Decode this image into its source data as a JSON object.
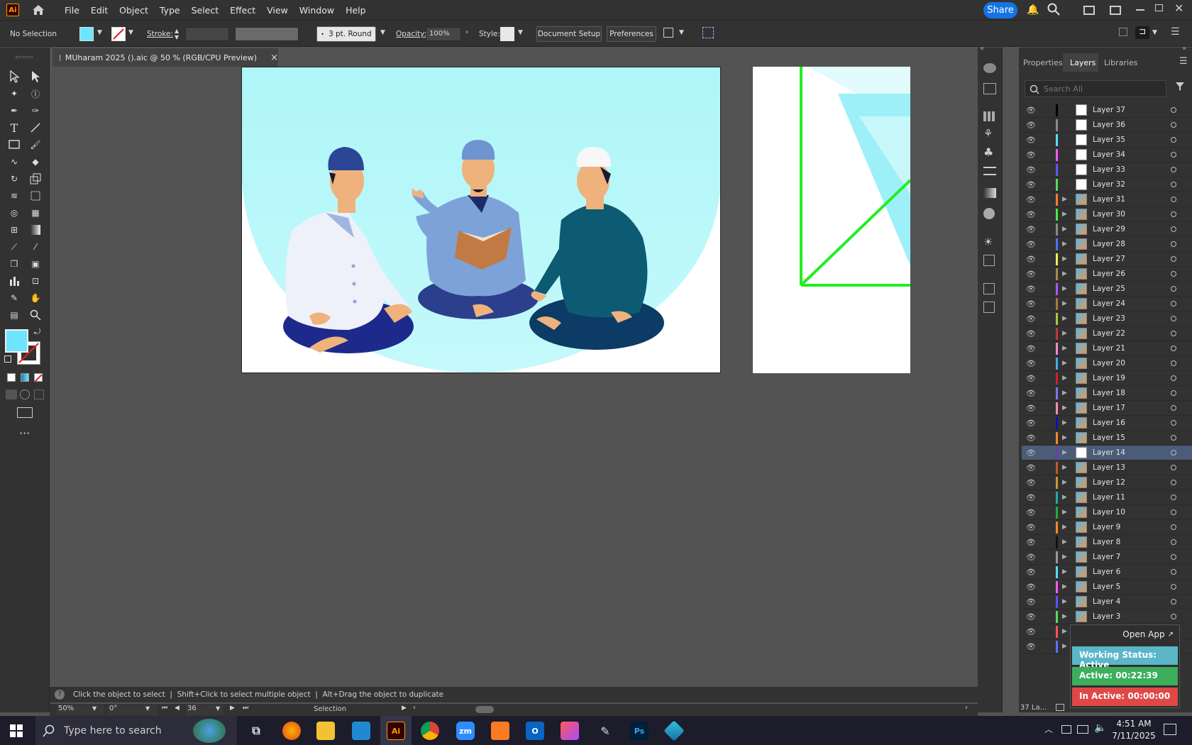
{
  "app": {
    "logo": "Ai",
    "menus": [
      "File",
      "Edit",
      "Object",
      "Type",
      "Select",
      "Effect",
      "View",
      "Window",
      "Help"
    ],
    "share_label": "Share"
  },
  "control": {
    "selection": "No Selection",
    "stroke_label": "Stroke:",
    "brush": "3 pt. Round",
    "opacity_label": "Opacity:",
    "opacity_value": "100%",
    "style_label": "Style:",
    "document_setup": "Document Setup",
    "preferences": "Preferences"
  },
  "document": {
    "tab_title": "MUharam 2025 ().aic @ 50 % (RGB/CPU Preview)"
  },
  "panel": {
    "tabs": [
      "Properties",
      "Layers",
      "Libraries"
    ],
    "search_placeholder": "Search All",
    "layer_count": "37 La..."
  },
  "layers": [
    {
      "name": "Layer 37",
      "color": "#000000",
      "expand": false,
      "thumb": "white"
    },
    {
      "name": "Layer 36",
      "color": "#8a8a8a",
      "expand": false,
      "thumb": "white"
    },
    {
      "name": "Layer 35",
      "color": "#55e0ff",
      "expand": false,
      "thumb": "white"
    },
    {
      "name": "Layer 34",
      "color": "#ff55ff",
      "expand": false,
      "thumb": "white"
    },
    {
      "name": "Layer 33",
      "color": "#5a5aff",
      "expand": false,
      "thumb": "white"
    },
    {
      "name": "Layer 32",
      "color": "#55dd55",
      "expand": false,
      "thumb": "white"
    },
    {
      "name": "Layer 31",
      "color": "#ff7a2a",
      "expand": true,
      "thumb": "pic"
    },
    {
      "name": "Layer 30",
      "color": "#44ee44",
      "expand": true,
      "thumb": "pic"
    },
    {
      "name": "Layer 29",
      "color": "#8a8a8a",
      "expand": true,
      "thumb": "pic"
    },
    {
      "name": "Layer 28",
      "color": "#4477ff",
      "expand": true,
      "thumb": "pic"
    },
    {
      "name": "Layer 27",
      "color": "#eeee55",
      "expand": true,
      "thumb": "pic"
    },
    {
      "name": "Layer 26",
      "color": "#aa8855",
      "expand": true,
      "thumb": "pic"
    },
    {
      "name": "Layer 25",
      "color": "#aa55ff",
      "expand": true,
      "thumb": "pic"
    },
    {
      "name": "Layer 24",
      "color": "#aa7744",
      "expand": true,
      "thumb": "pic"
    },
    {
      "name": "Layer 23",
      "color": "#aacc33",
      "expand": true,
      "thumb": "pic"
    },
    {
      "name": "Layer 22",
      "color": "#cc3333",
      "expand": true,
      "thumb": "pic"
    },
    {
      "name": "Layer 21",
      "color": "#ff88cc",
      "expand": true,
      "thumb": "pic"
    },
    {
      "name": "Layer 20",
      "color": "#44aaff",
      "expand": true,
      "thumb": "pic"
    },
    {
      "name": "Layer 19",
      "color": "#cc2222",
      "expand": true,
      "thumb": "pic"
    },
    {
      "name": "Layer 18",
      "color": "#7777ff",
      "expand": true,
      "thumb": "pic"
    },
    {
      "name": "Layer 17",
      "color": "#ff88bb",
      "expand": true,
      "thumb": "pic"
    },
    {
      "name": "Layer 16",
      "color": "#1111aa",
      "expand": true,
      "thumb": "pic"
    },
    {
      "name": "Layer 15",
      "color": "#ff8822",
      "expand": true,
      "thumb": "pic"
    },
    {
      "name": "Layer 14",
      "color": "#6a3db0",
      "expand": true,
      "thumb": "white",
      "selected": true
    },
    {
      "name": "Layer 13",
      "color": "#cc5522",
      "expand": true,
      "thumb": "pic"
    },
    {
      "name": "Layer 12",
      "color": "#cc9933",
      "expand": true,
      "thumb": "pic"
    },
    {
      "name": "Layer 11",
      "color": "#22aaaa",
      "expand": true,
      "thumb": "pic"
    },
    {
      "name": "Layer 10",
      "color": "#22aa44",
      "expand": true,
      "thumb": "pic"
    },
    {
      "name": "Layer 9",
      "color": "#ff8822",
      "expand": true,
      "thumb": "pic"
    },
    {
      "name": "Layer 8",
      "color": "#111111",
      "expand": true,
      "thumb": "pic"
    },
    {
      "name": "Layer 7",
      "color": "#999999",
      "expand": true,
      "thumb": "pic"
    },
    {
      "name": "Layer 6",
      "color": "#55ddff",
      "expand": true,
      "thumb": "pic"
    },
    {
      "name": "Layer 5",
      "color": "#ff55ff",
      "expand": true,
      "thumb": "pic"
    },
    {
      "name": "Layer 4",
      "color": "#5555ff",
      "expand": true,
      "thumb": "pic"
    },
    {
      "name": "Layer 3",
      "color": "#55dd55",
      "expand": true,
      "thumb": "pic"
    },
    {
      "name": "Layer 2",
      "color": "#ff5555",
      "expand": true,
      "thumb": "pic"
    },
    {
      "name": "Layer 1",
      "color": "#5577ff",
      "expand": true,
      "thumb": "pic"
    }
  ],
  "widget": {
    "open_app": "Open App",
    "status": "Working Status: Active",
    "active": "Active: 00:22:39",
    "inactive": "In Active: 00:00:00"
  },
  "status": {
    "hint": "Click the object to select  |  Shift+Click to select multiple object  |  Alt+Drag the object to duplicate",
    "zoom": "50%",
    "rotation": "0°",
    "artboard": "36",
    "tool": "Selection"
  },
  "taskbar": {
    "search_placeholder": "Type here to search",
    "time": "4:51 AM",
    "date": "7/11/2025"
  }
}
